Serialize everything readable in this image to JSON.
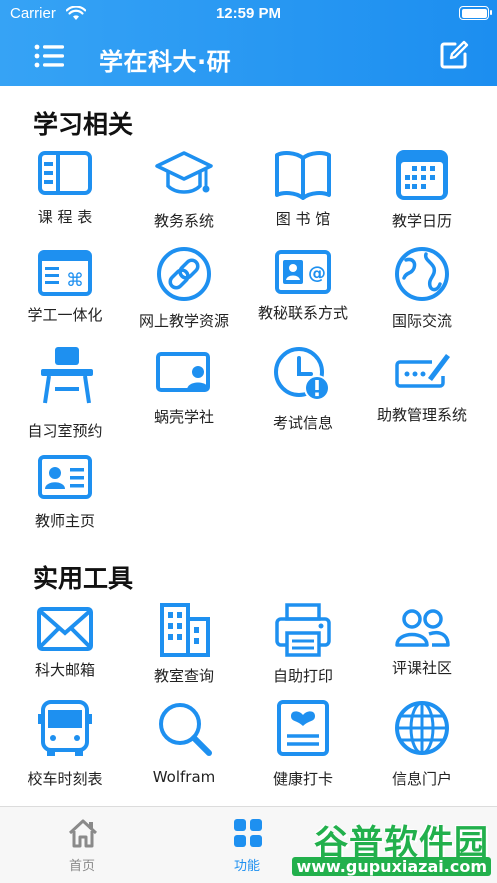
{
  "status_bar": {
    "carrier": "Carrier",
    "time": "12:59 PM"
  },
  "header": {
    "title": "学在科大·研"
  },
  "colors": {
    "primary": "#1e90f0",
    "header_gradient_start": "#36a3f5",
    "text": "#222222",
    "watermark": "#22b04c"
  },
  "sections": {
    "study": {
      "title": "学习相关",
      "items": [
        {
          "label": "课 程 表",
          "icon": "timetable-icon"
        },
        {
          "label": "教务系统",
          "icon": "graduation-cap-icon"
        },
        {
          "label": "图 书 馆",
          "icon": "book-icon"
        },
        {
          "label": "教学日历",
          "icon": "calendar-icon"
        },
        {
          "label": "学工一体化",
          "icon": "command-window-icon"
        },
        {
          "label": "网上教学资源",
          "icon": "link-icon"
        },
        {
          "label": "教秘联系方式",
          "icon": "contact-card-icon"
        },
        {
          "label": "国际交流",
          "icon": "globe-icon"
        },
        {
          "label": "自习室预约",
          "icon": "desk-chair-icon"
        },
        {
          "label": "蜗壳学社",
          "icon": "presentation-icon"
        },
        {
          "label": "考试信息",
          "icon": "clock-alert-icon"
        },
        {
          "label": "助教管理系统",
          "icon": "password-edit-icon"
        },
        {
          "label": "教师主页",
          "icon": "id-card-icon"
        }
      ]
    },
    "tools": {
      "title": "实用工具",
      "items": [
        {
          "label": "科大邮箱",
          "icon": "envelope-icon"
        },
        {
          "label": "教室查询",
          "icon": "building-icon"
        },
        {
          "label": "自助打印",
          "icon": "printer-icon"
        },
        {
          "label": "评课社区",
          "icon": "people-icon"
        },
        {
          "label": "校车时刻表",
          "icon": "bus-icon"
        },
        {
          "label": "Wolfram",
          "icon": "magnifier-icon"
        },
        {
          "label": "健康打卡",
          "icon": "health-card-icon"
        },
        {
          "label": "信息门户",
          "icon": "globe-grid-icon"
        }
      ]
    }
  },
  "tabbar": {
    "tabs": [
      {
        "label": "首页",
        "icon": "home-icon"
      },
      {
        "label": "功能",
        "icon": "grid-icon"
      }
    ]
  },
  "watermark": {
    "title": "谷普软件园",
    "url": "www.gupuxiazai.com"
  }
}
